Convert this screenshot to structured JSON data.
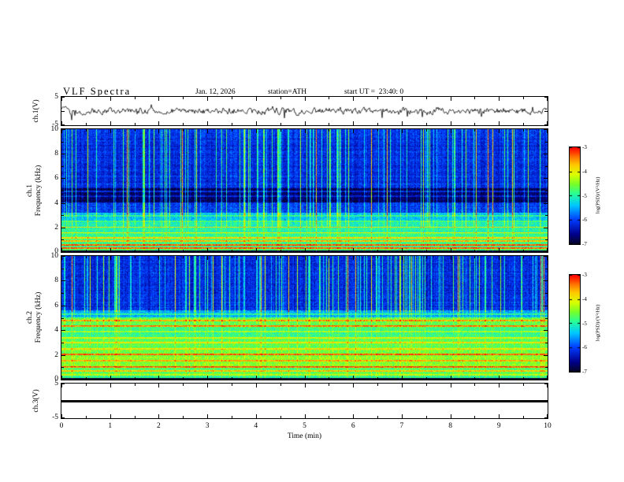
{
  "header": {
    "title": "VLF Spectra",
    "date": "Jan. 12, 2026",
    "station": "station=ATH",
    "start_ut": "start UT =  23:40: 0"
  },
  "time_axis": {
    "label": "Time (min)",
    "ticks": [
      "0",
      "1",
      "2",
      "3",
      "4",
      "5",
      "6",
      "7",
      "8",
      "9",
      "10"
    ],
    "range": [
      0,
      10
    ]
  },
  "panels": {
    "waveform": {
      "ylabel": "ch.1(V)",
      "ytick_top": "5",
      "ytick_bottom": "-5",
      "ylim": [
        -5,
        5
      ]
    },
    "spec1": {
      "channel": "ch.1",
      "axis": "Frequency (kHz)",
      "yticks": [
        "0",
        "2",
        "4",
        "6",
        "8",
        "10"
      ],
      "ylim": [
        0,
        10
      ]
    },
    "spec2": {
      "channel": "ch.2",
      "axis": "Frequency (kHz)",
      "yticks": [
        "0",
        "2",
        "4",
        "6",
        "8",
        "10"
      ],
      "ylim": [
        0,
        10
      ]
    },
    "ch3": {
      "ylabel": "ch.3(V)",
      "ytick_top": "5",
      "ytick_bottom": "-5",
      "ylim": [
        -5,
        5
      ]
    }
  },
  "colorbar": {
    "label": "log(PSD)/(V²/Hz)",
    "ticks": [
      "-3",
      "-4",
      "-5",
      "-6",
      "-7"
    ],
    "min": -7,
    "max": -3
  },
  "chart_data": [
    {
      "type": "line",
      "panel": "ch.1(V) waveform",
      "xlabel": "Time (min)",
      "xlim": [
        0,
        10
      ],
      "ylabel": "ch.1(V)",
      "ylim": [
        -5,
        5
      ],
      "series_color": "#000000",
      "description": "Broadband noise trace centered on 0 V, typical amplitude about ±1 V with frequent narrow spikes reaching about ±2.5 V over the full 10-minute record."
    },
    {
      "type": "heatmap",
      "panel": "ch.1 spectrogram",
      "xlabel": "Time (min)",
      "xlim": [
        0,
        10
      ],
      "ylabel": "Frequency (kHz)",
      "ylim": [
        0,
        10
      ],
      "zlabel": "log(PSD)/(V²/Hz)",
      "zlim": [
        -7,
        -3
      ],
      "colormap": "rainbow (dark navy = -7, blue, cyan, green, yellow, red = -3)",
      "features": [
        "5-10 kHz: low PSD near -6.2 (blue) crossed by dense vertical sferic streaks of higher PSD (cyan/green)",
        "4-5 kHz: darkest horizontal band, PSD near -6.8 (dark navy) with thin cyan lines near 4.6 and 5.0 kHz",
        "0-3 kHz: elevated PSD -5.5 to -4.8 (cyan/green) with many yellow horizontal interference lines",
        "strong orange-red lines near 0.3, 0.55, 0.85, 1.15 and 2.0 kHz",
        "thin dark band along the very bottom edge (~0 kHz)"
      ]
    },
    {
      "type": "heatmap",
      "panel": "ch.2 spectrogram",
      "xlabel": "Time (min)",
      "xlim": [
        0,
        10
      ],
      "ylabel": "Frequency (kHz)",
      "ylim": [
        0,
        10
      ],
      "zlabel": "log(PSD)/(V²/Hz)",
      "zlim": [
        -7,
        -3
      ],
      "colormap": "rainbow (dark navy = -7, blue, cyan, green, yellow, red = -3)",
      "features": [
        "5.5-10 kHz: low PSD near -6.2 (blue) with dense vertical sferic streaks (cyan/green)",
        "0-5 kHz: high PSD -5.0 to -4.3 (green/yellow) with strong horizontal banding",
        "prominent orange-red lines near 4.35, 4.75, 2.0 and 1.0 kHz",
        "thin dark band along the very bottom edge (~0 kHz)"
      ]
    },
    {
      "type": "line",
      "panel": "ch.3(V) waveform",
      "xlabel": "Time (min)",
      "xlim": [
        0,
        10
      ],
      "ylabel": "ch.3(V)",
      "ylim": [
        -5,
        5
      ],
      "series_color": "#000000",
      "description": "Completely flat thick black line at 0 V for the entire record (dead channel)."
    }
  ]
}
